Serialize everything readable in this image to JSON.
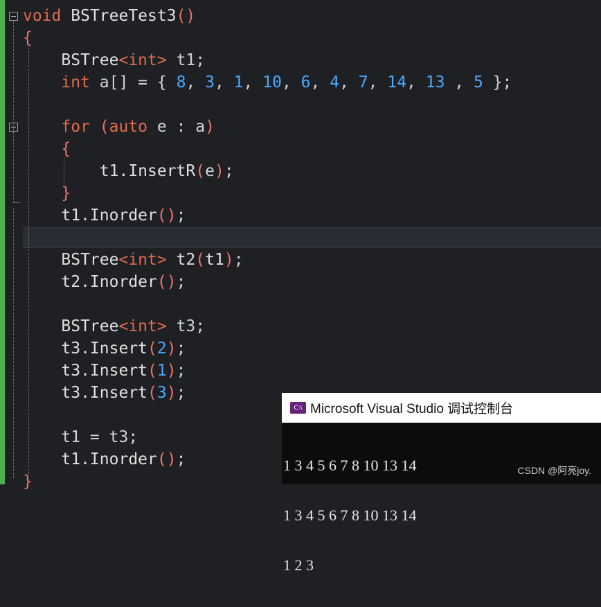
{
  "code": {
    "lines": [
      [
        {
          "t": "void ",
          "c": "kw"
        },
        {
          "t": "BSTreeTest3",
          "c": "fn"
        },
        {
          "t": "()",
          "c": "par"
        }
      ],
      [
        {
          "t": "{",
          "c": "par"
        }
      ],
      [
        {
          "t": "    BSTree",
          "c": "fn"
        },
        {
          "t": "<int>",
          "c": "kw"
        },
        {
          "t": " t1;",
          "c": "pun"
        }
      ],
      [
        {
          "t": "    int ",
          "c": "kw"
        },
        {
          "t": "a[] = { ",
          "c": "pun"
        },
        {
          "t": "8",
          "c": "num"
        },
        {
          "t": ", ",
          "c": "pun"
        },
        {
          "t": "3",
          "c": "num"
        },
        {
          "t": ", ",
          "c": "pun"
        },
        {
          "t": "1",
          "c": "num"
        },
        {
          "t": ", ",
          "c": "pun"
        },
        {
          "t": "10",
          "c": "num"
        },
        {
          "t": ", ",
          "c": "pun"
        },
        {
          "t": "6",
          "c": "num"
        },
        {
          "t": ", ",
          "c": "pun"
        },
        {
          "t": "4",
          "c": "num"
        },
        {
          "t": ", ",
          "c": "pun"
        },
        {
          "t": "7",
          "c": "num"
        },
        {
          "t": ", ",
          "c": "pun"
        },
        {
          "t": "14",
          "c": "num"
        },
        {
          "t": ", ",
          "c": "pun"
        },
        {
          "t": "13",
          "c": "num"
        },
        {
          "t": " , ",
          "c": "pun"
        },
        {
          "t": "5",
          "c": "num"
        },
        {
          "t": " };",
          "c": "pun"
        }
      ],
      [],
      [
        {
          "t": "    for ",
          "c": "kw"
        },
        {
          "t": "(",
          "c": "par"
        },
        {
          "t": "auto ",
          "c": "kw"
        },
        {
          "t": "e : a",
          "c": "pun"
        },
        {
          "t": ")",
          "c": "par"
        }
      ],
      [
        {
          "t": "    {",
          "c": "par"
        }
      ],
      [
        {
          "t": "        t1.InsertR",
          "c": "fn"
        },
        {
          "t": "(",
          "c": "par"
        },
        {
          "t": "e",
          "c": "pun"
        },
        {
          "t": ")",
          "c": "par"
        },
        {
          "t": ";",
          "c": "pun"
        }
      ],
      [
        {
          "t": "    }",
          "c": "par"
        }
      ],
      [
        {
          "t": "    t1.Inorder",
          "c": "fn"
        },
        {
          "t": "()",
          "c": "par"
        },
        {
          "t": ";",
          "c": "pun"
        }
      ],
      [],
      [
        {
          "t": "    BSTree",
          "c": "fn"
        },
        {
          "t": "<int>",
          "c": "kw"
        },
        {
          "t": " t2",
          "c": "fn"
        },
        {
          "t": "(",
          "c": "par"
        },
        {
          "t": "t1",
          "c": "fn"
        },
        {
          "t": ")",
          "c": "par"
        },
        {
          "t": ";",
          "c": "pun"
        }
      ],
      [
        {
          "t": "    t2.Inorder",
          "c": "fn"
        },
        {
          "t": "()",
          "c": "par"
        },
        {
          "t": ";",
          "c": "pun"
        }
      ],
      [],
      [
        {
          "t": "    BSTree",
          "c": "fn"
        },
        {
          "t": "<int>",
          "c": "kw"
        },
        {
          "t": " t3;",
          "c": "pun"
        }
      ],
      [
        {
          "t": "    t3.Insert",
          "c": "fn"
        },
        {
          "t": "(",
          "c": "par"
        },
        {
          "t": "2",
          "c": "num"
        },
        {
          "t": ")",
          "c": "par"
        },
        {
          "t": ";",
          "c": "pun"
        }
      ],
      [
        {
          "t": "    t3.Insert",
          "c": "fn"
        },
        {
          "t": "(",
          "c": "par"
        },
        {
          "t": "1",
          "c": "num"
        },
        {
          "t": ")",
          "c": "par"
        },
        {
          "t": ";",
          "c": "pun"
        }
      ],
      [
        {
          "t": "    t3.Insert",
          "c": "fn"
        },
        {
          "t": "(",
          "c": "par"
        },
        {
          "t": "3",
          "c": "num"
        },
        {
          "t": ")",
          "c": "par"
        },
        {
          "t": ";",
          "c": "pun"
        }
      ],
      [],
      [
        {
          "t": "    t1 = t3;",
          "c": "pun"
        }
      ],
      [
        {
          "t": "    t1.Inorder",
          "c": "fn"
        },
        {
          "t": "()",
          "c": "par"
        },
        {
          "t": ";",
          "c": "pun"
        }
      ],
      [
        {
          "t": "}",
          "c": "par"
        }
      ]
    ]
  },
  "console": {
    "title": "Microsoft Visual Studio 调试控制台",
    "icon_label": "C:\\",
    "output": [
      "1 3 4 5 6 7 8 10 13 14",
      "1 3 4 5 6 7 8 10 13 14",
      "1 2 3"
    ]
  },
  "watermark": "CSDN @阿亮joy.",
  "colors": {
    "keyword": "#e06c4c",
    "number": "#4aa8ff",
    "identifier": "#e0e0e0",
    "paren": "#f07070",
    "change_bar": "#4caf50",
    "console_icon": "#68217a"
  }
}
